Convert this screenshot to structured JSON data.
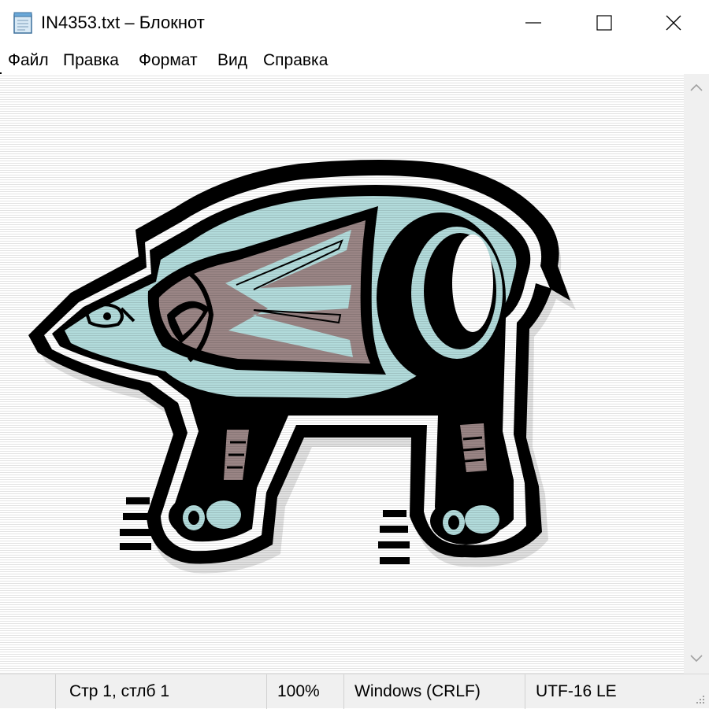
{
  "window": {
    "title": "IN4353.txt – Блокнот",
    "icon": "notepad-icon"
  },
  "controls": {
    "minimize_icon": "minimize-icon",
    "maximize_icon": "maximize-icon",
    "close_icon": "close-icon"
  },
  "menu": {
    "items": [
      {
        "label": "Файл"
      },
      {
        "label": "Правка"
      },
      {
        "label": "Формат"
      },
      {
        "label": "Вид"
      },
      {
        "label": "Справка"
      }
    ]
  },
  "content": {
    "image_subject": "bear-figure",
    "colors": {
      "body_fill": "#b2dbdb",
      "pattern_fill": "#9a8585",
      "outline": "#000000",
      "background": "#ffffff"
    }
  },
  "scrollbar": {
    "up_icon": "chevron-up-icon",
    "down_icon": "chevron-down-icon"
  },
  "status": {
    "position": "Стр 1, стлб 1",
    "zoom": "100%",
    "line_endings": "Windows (CRLF)",
    "encoding": "UTF-16 LE"
  }
}
